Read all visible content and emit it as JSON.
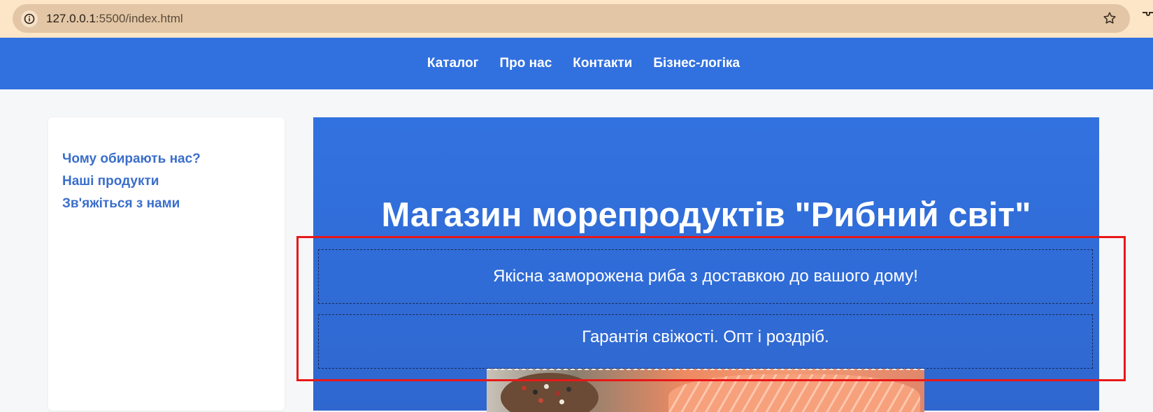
{
  "browser": {
    "url_host": "127.0.0.1",
    "url_rest": ":5500/index.html"
  },
  "nav": {
    "items": [
      "Каталог",
      "Про нас",
      "Контакти",
      "Бізнес-логіка"
    ]
  },
  "sidebar": {
    "links": [
      "Чому обирають нас?",
      "Наші продукти",
      "Зв'яжіться з нами"
    ]
  },
  "hero": {
    "title": "Магазин морепродуктів \"Рибний світ\"",
    "subtitle1": "Якісна заморожена риба з доставкою до вашого дому!",
    "subtitle2": "Гарантія свіжості. Опт і роздріб."
  },
  "colors": {
    "nav_bg": "#3170df",
    "hero_bg": "#3272e0",
    "sidebar_link": "#3a6ecb",
    "highlight": "#e81818",
    "browser_bar": "#fde6c8"
  }
}
